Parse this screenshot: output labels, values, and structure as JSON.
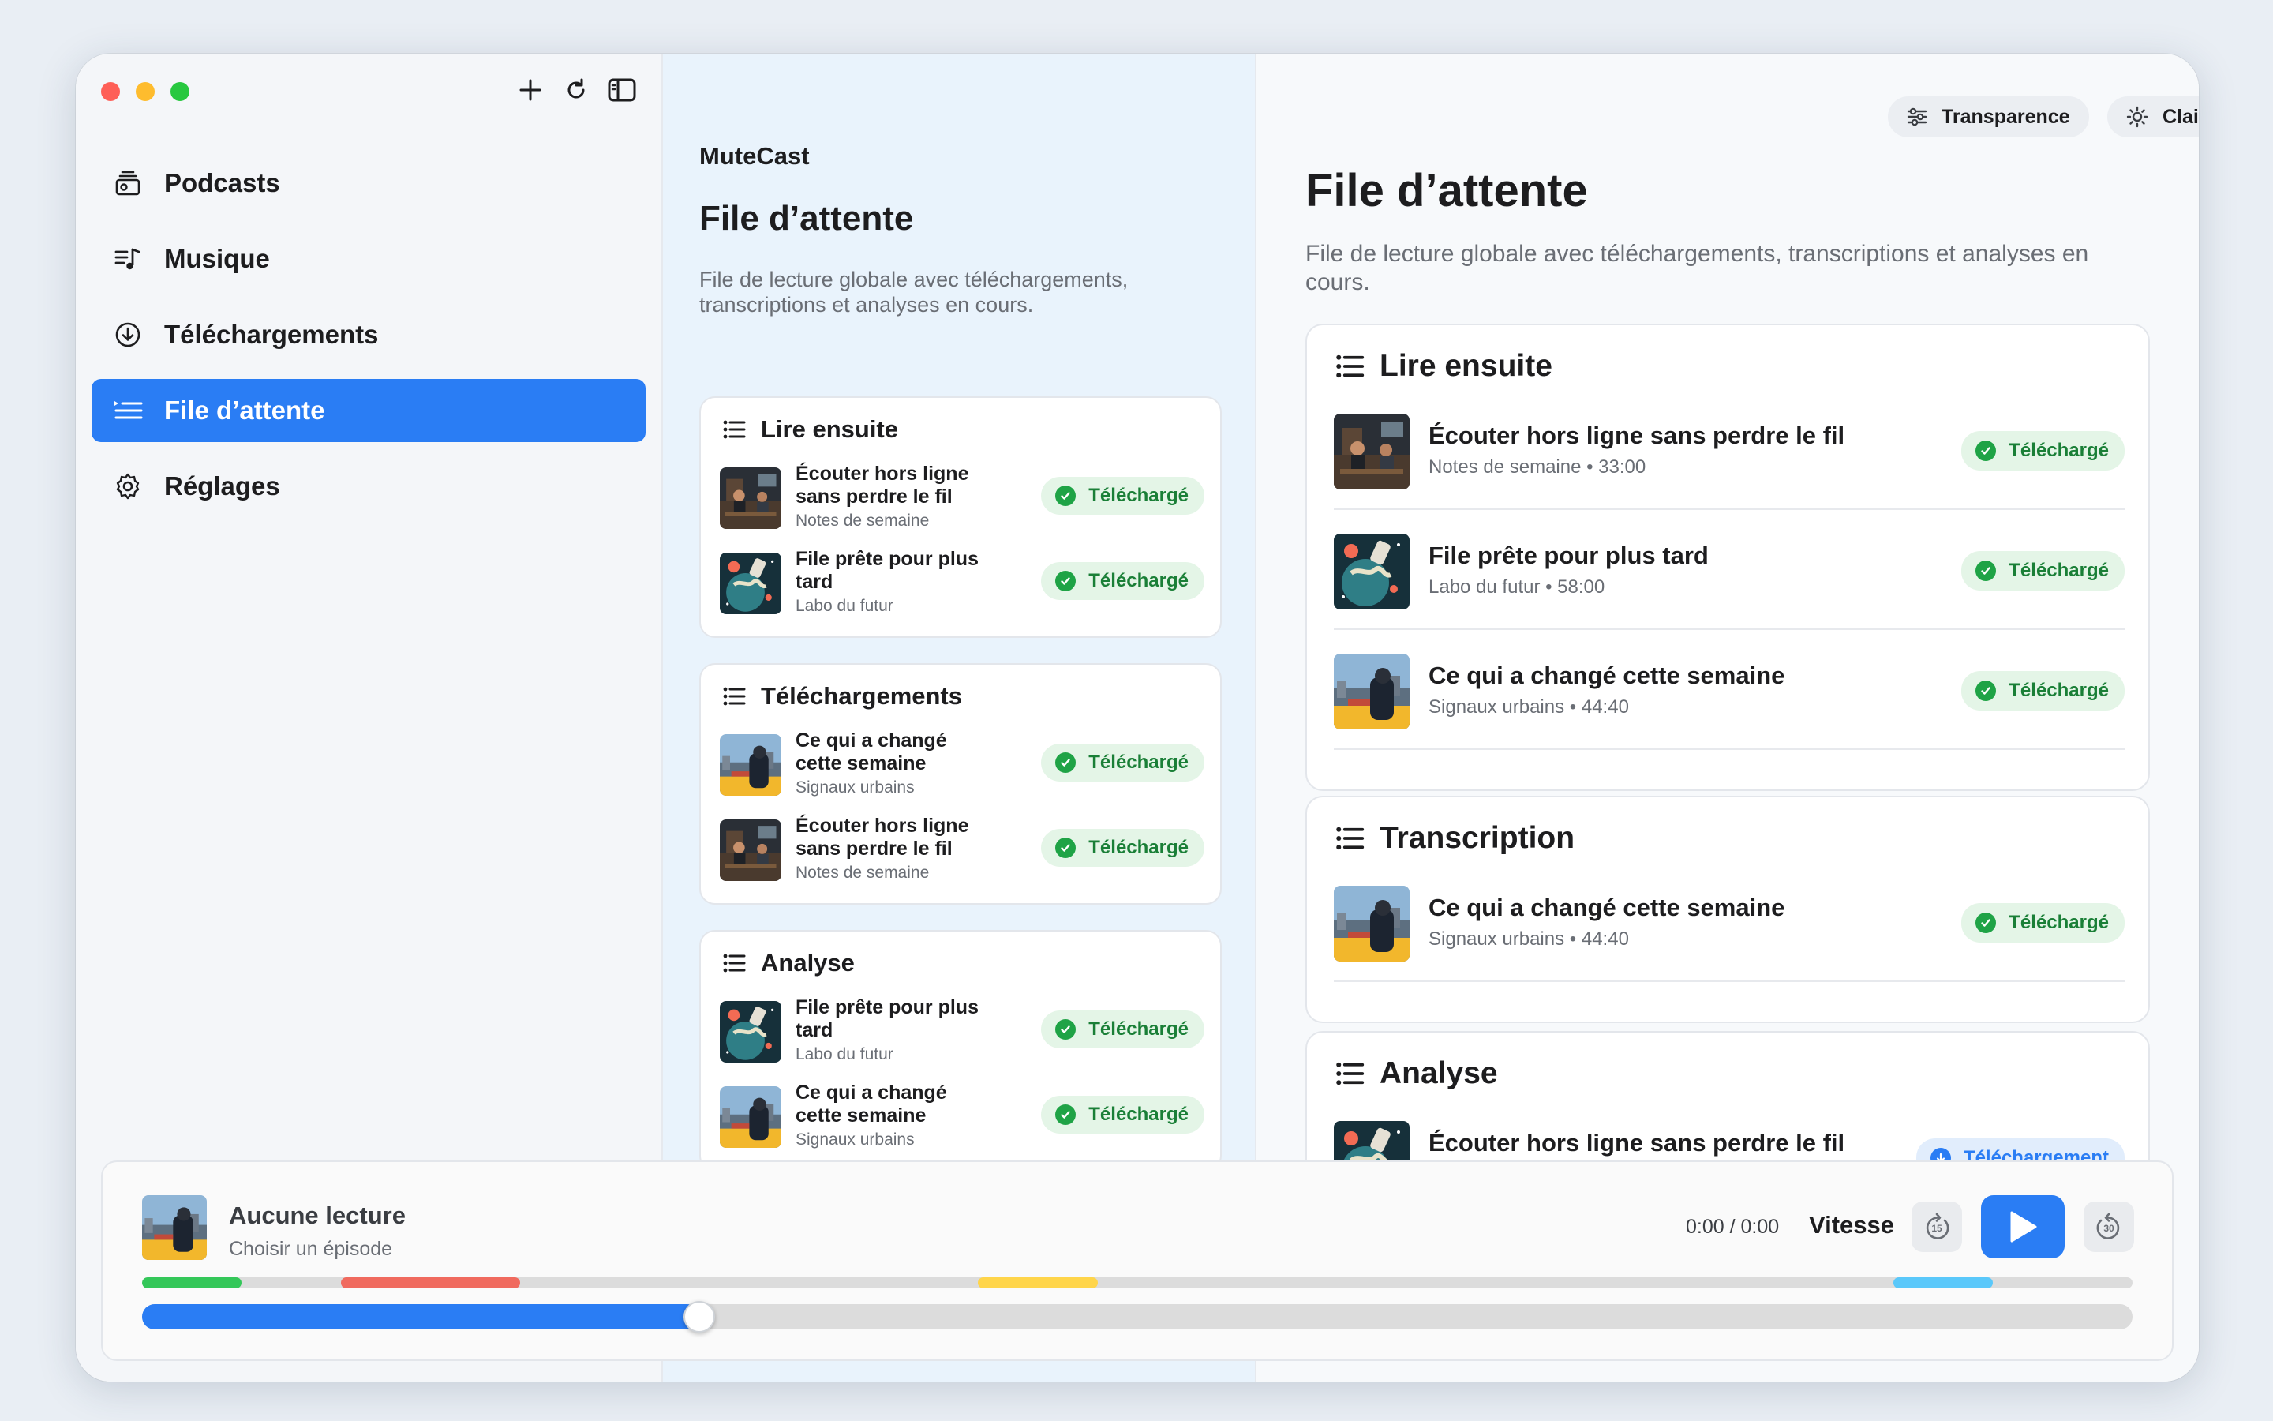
{
  "colors": {
    "accent": "#2a7df4",
    "success": "#1fa346",
    "close": "#fe5f57",
    "minimize": "#febc2e",
    "zoom": "#28c840"
  },
  "sidebar": {
    "items": [
      {
        "label": "Podcasts",
        "icon": "podcast-stack-icon",
        "active": false
      },
      {
        "label": "Musique",
        "icon": "music-list-icon",
        "active": false
      },
      {
        "label": "Téléchargements",
        "icon": "download-circle-icon",
        "active": false
      },
      {
        "label": "File d’attente",
        "icon": "queue-list-icon",
        "active": true
      },
      {
        "label": "Réglages",
        "icon": "gear-icon",
        "active": false
      }
    ]
  },
  "middle": {
    "app_name": "MuteCast",
    "title": "File d’attente",
    "subtitle": "File de lecture globale avec téléchargements, transcriptions et analyses en cours.",
    "sections": [
      {
        "title": "Lire ensuite",
        "rows": [
          {
            "title": "Écouter hors ligne sans perdre le fil",
            "meta": "Notes de semaine",
            "badge": "Téléchargé",
            "thumb": "studio"
          },
          {
            "title": "File prête pour plus tard",
            "meta": "Labo du futur",
            "badge": "Téléchargé",
            "thumb": "space"
          }
        ]
      },
      {
        "title": "Téléchargements",
        "rows": [
          {
            "title": "Ce qui a changé cette semaine",
            "meta": "Signaux urbains",
            "badge": "Téléchargé",
            "thumb": "city"
          },
          {
            "title": "Écouter hors ligne sans perdre le fil",
            "meta": "Notes de semaine",
            "badge": "Téléchargé",
            "thumb": "studio"
          }
        ]
      },
      {
        "title": "Analyse",
        "rows": [
          {
            "title": "File prête pour plus tard",
            "meta": "Labo du futur",
            "badge": "Téléchargé",
            "thumb": "space"
          },
          {
            "title": "Ce qui a changé cette semaine",
            "meta": "Signaux urbains",
            "badge": "Téléchargé",
            "thumb": "city"
          }
        ]
      }
    ]
  },
  "right": {
    "transparency_label": "Transparence",
    "theme_label": "Clair",
    "title": "File d’attente",
    "subtitle": "File de lecture globale avec téléchargements, transcriptions et analyses en cours.",
    "sections": [
      {
        "title": "Lire ensuite",
        "rows": [
          {
            "title": "Écouter hors ligne sans perdre le fil",
            "meta": "Notes de semaine • 33:00",
            "badge": "Téléchargé",
            "thumb": "studio"
          },
          {
            "title": "File prête pour plus tard",
            "meta": "Labo du futur • 58:00",
            "badge": "Téléchargé",
            "thumb": "space"
          },
          {
            "title": "Ce qui a changé cette semaine",
            "meta": "Signaux urbains • 44:40",
            "badge": "Téléchargé",
            "thumb": "city"
          }
        ]
      },
      {
        "title": "Transcription",
        "rows": [
          {
            "title": "Ce qui a changé cette semaine",
            "meta": "Signaux urbains • 44:40",
            "badge": "Téléchargé",
            "thumb": "city"
          }
        ]
      },
      {
        "title": "Analyse",
        "rows": [
          {
            "title": "Écouter hors ligne sans perdre le fil",
            "meta": "",
            "badge": "Téléchargement",
            "thumb": "space"
          }
        ]
      }
    ]
  },
  "player": {
    "title": "Aucune lecture",
    "subtitle": "Choisir un épisode",
    "time": "0:00 / 0:00",
    "speed_label": "Vitesse",
    "skip_back": "15",
    "skip_forward": "30",
    "progress_fraction": 0.28,
    "chapters": [
      {
        "start": 0.0,
        "end": 0.05,
        "color": "#34c759"
      },
      {
        "start": 0.1,
        "end": 0.19,
        "color": "#f06a5e"
      },
      {
        "start": 0.42,
        "end": 0.48,
        "color": "#ffd54a"
      },
      {
        "start": 0.88,
        "end": 0.93,
        "color": "#5ac8fa"
      }
    ]
  }
}
